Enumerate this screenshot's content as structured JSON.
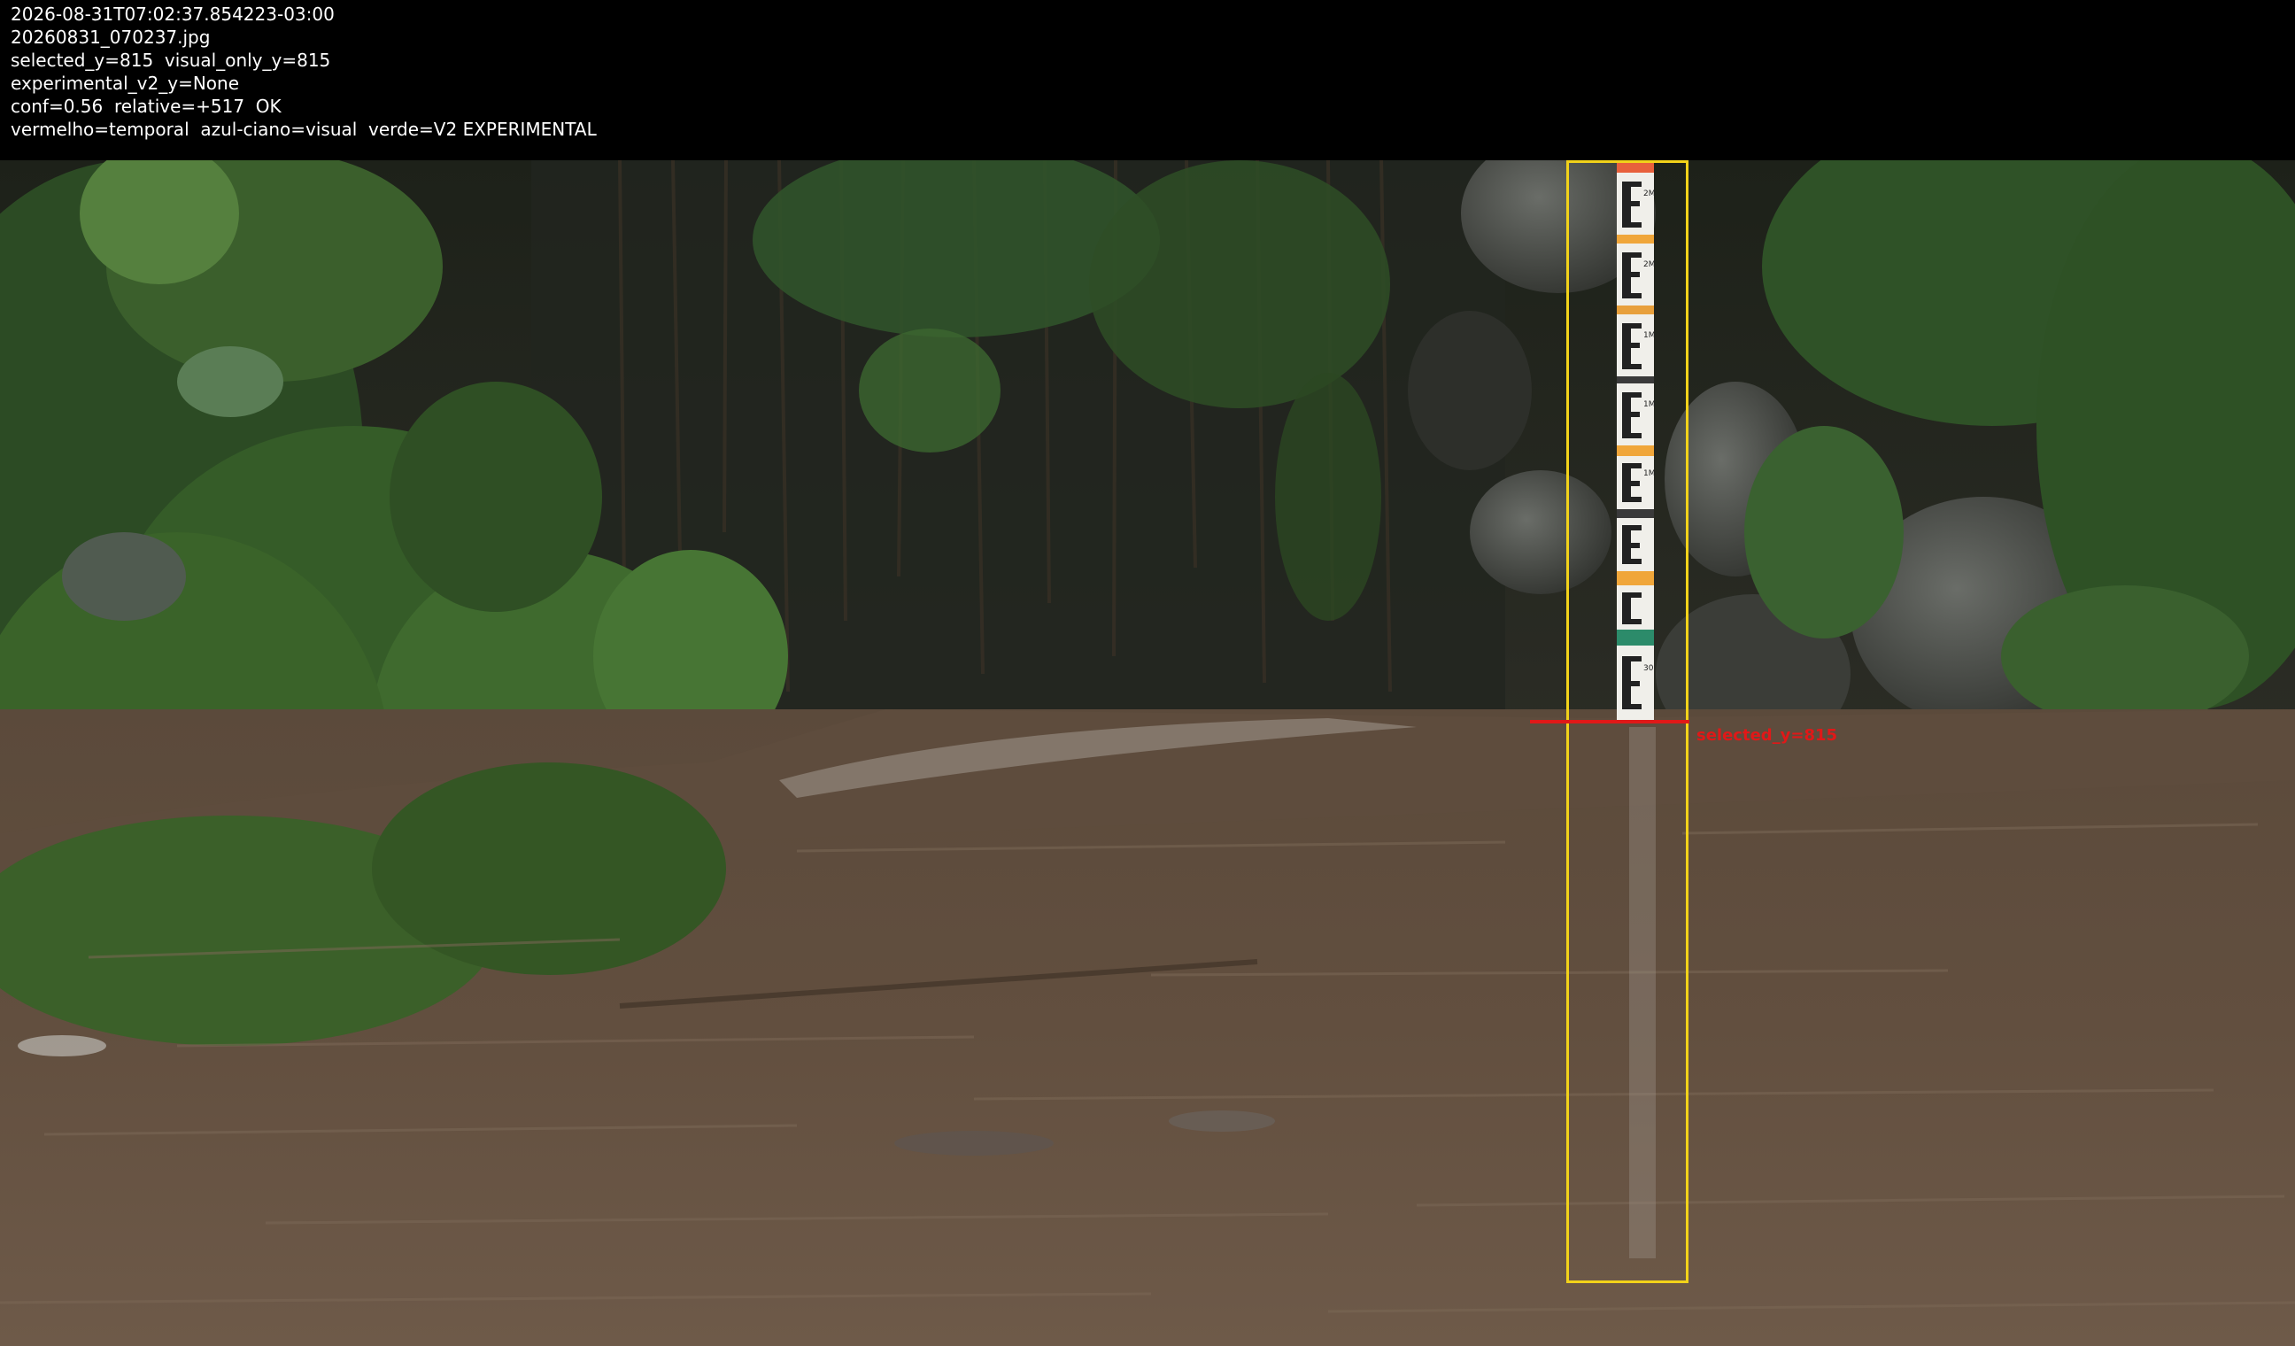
{
  "header": {
    "timestamp": "2026-08-31T07:02:37.854223-03:00",
    "filename": "20260831_070237.jpg",
    "selection_line": "selected_y=815  visual_only_y=815",
    "experimental_line": "experimental_v2_y=None",
    "confidence_line": "conf=0.56  relative=+517  OK",
    "legend_line": "vermelho=temporal  azul-ciano=visual  verde=V2 EXPERIMENTAL"
  },
  "overlay": {
    "level_label": "selected_y=815",
    "roi_color": "#f2d21a",
    "level_color": "#e01818"
  },
  "gauge": {
    "marks": [
      "2M",
      "2M",
      "1M",
      "1M",
      "1M",
      "30"
    ]
  }
}
